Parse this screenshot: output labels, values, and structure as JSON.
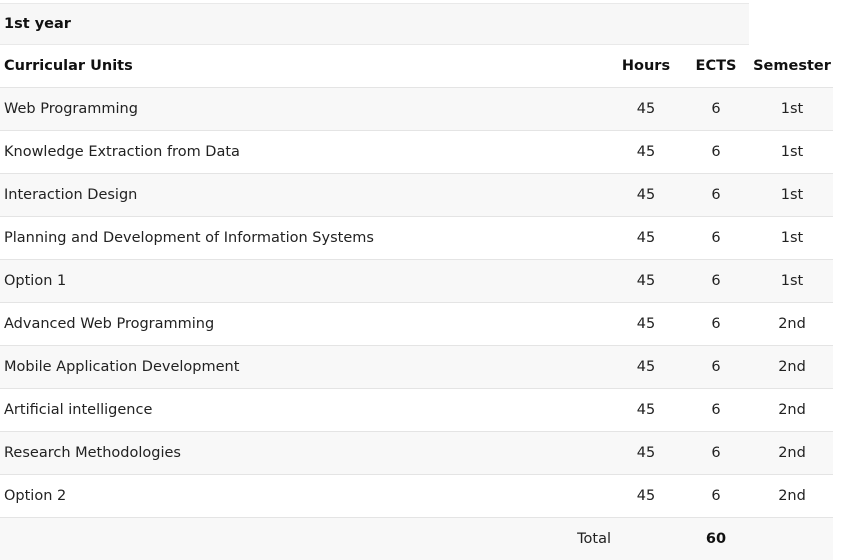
{
  "year_title": "1st year",
  "columns": {
    "unit": "Curricular Units",
    "hours": "Hours",
    "ects": "ECTS",
    "semester": "Semester"
  },
  "rows": [
    {
      "unit": "Web Programming",
      "hours": "45",
      "ects": "6",
      "semester": "1st"
    },
    {
      "unit": "Knowledge Extraction from Data",
      "hours": "45",
      "ects": "6",
      "semester": "1st"
    },
    {
      "unit": "Interaction Design",
      "hours": "45",
      "ects": "6",
      "semester": "1st"
    },
    {
      "unit": "Planning and Development of Information Systems",
      "hours": "45",
      "ects": "6",
      "semester": "1st"
    },
    {
      "unit": "Option 1",
      "hours": "45",
      "ects": "6",
      "semester": "1st"
    },
    {
      "unit": "Advanced Web Programming",
      "hours": "45",
      "ects": "6",
      "semester": "2nd"
    },
    {
      "unit": "Mobile Application Development",
      "hours": "45",
      "ects": "6",
      "semester": "2nd"
    },
    {
      "unit": "Artificial intelligence",
      "hours": "45",
      "ects": "6",
      "semester": "2nd"
    },
    {
      "unit": "Research Methodologies",
      "hours": "45",
      "ects": "6",
      "semester": "2nd"
    },
    {
      "unit": "Option 2",
      "hours": "45",
      "ects": "6",
      "semester": "2nd"
    }
  ],
  "total": {
    "label": "Total",
    "ects": "60"
  }
}
